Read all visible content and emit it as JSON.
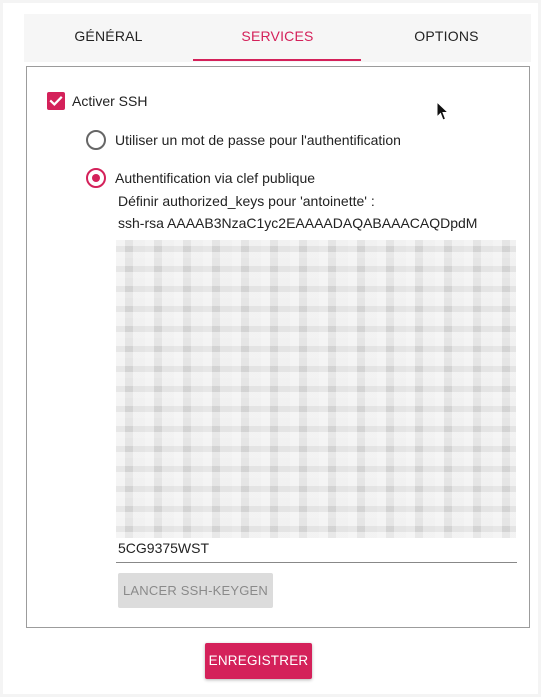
{
  "tabs": [
    {
      "label": "GÉNÉRAL"
    },
    {
      "label": "SERVICES"
    },
    {
      "label": "OPTIONS"
    }
  ],
  "ssh": {
    "enable_label": "Activer SSH",
    "enabled": true,
    "password_option": "Utiliser un mot de passe pour l'authentification",
    "pubkey_option": "Authentification via clef publique",
    "selected_option": "pubkey",
    "authorized_keys_label": "Définir authorized_keys pour 'antoinette' :",
    "key_first_line": "ssh-rsa AAAAB3NzaC1yc2EAAAADAQABAAACAQDpdM",
    "key_last_line": "5CG9375WST"
  },
  "buttons": {
    "keygen_label": "LANCER SSH-KEYGEN",
    "save_label": "ENREGISTRER"
  },
  "colors": {
    "accent": "#d4215a",
    "disabled_button": "#dcdcdc"
  }
}
